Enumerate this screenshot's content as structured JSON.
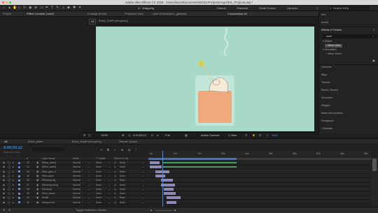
{
  "app": {
    "title": "Adobe After Effects CC 2018 - /Users/lucio/Documents/mi/021/Projects/Argo/021_Project2.aep *"
  },
  "toolbar": {
    "snapping_label": "Snapping",
    "workspaces": [
      "Default",
      "Standard",
      "Small Screen",
      "Libraries"
    ],
    "search_placeholder": "Search Help"
  },
  "project_panel": {
    "tab": "Project"
  },
  "effect_controls_panel": {
    "tab": "Effect Controls (none)"
  },
  "viewer_tabs": [
    "Footage (none)",
    "Flowchart (none)",
    "Layer tEAsidebtes_glassmp",
    "Composition All"
  ],
  "comp_breadcrumb": {
    "all": "All",
    "comp": "tEtea_fluidPouringering"
  },
  "viewer_footer": {
    "zoom": "100%",
    "timecode": "0;00;03;12",
    "resolution": "Full",
    "camera": "Active Camera",
    "view": "1 View",
    "offset": "+0.0"
  },
  "right_panel": {
    "items": [
      "Info",
      "Audio"
    ],
    "effects_title": "Effects & Presets",
    "search_value": "wave",
    "tree": [
      {
        "label": "Distort",
        "indent": 0
      },
      {
        "label": "Wave Warp",
        "indent": 1,
        "selected": true
      },
      {
        "label": "Simulation",
        "indent": 0
      },
      {
        "label": "Wave World",
        "indent": 1,
        "selected": false
      }
    ],
    "items_bottom": [
      "Libraries",
      "Align",
      "Tracker",
      "Motion Sketch",
      "Smoother",
      "Wiggler",
      "Mask Interpolation",
      "Paragraph",
      "Character"
    ]
  },
  "timeline": {
    "tabs": [
      "All",
      "tEtea_water",
      "tEtea_fluidPouringering",
      "Render Queue"
    ],
    "timecode": "0;00;03;12",
    "frame_info": "00102 (29.97 fps)",
    "search_placeholder": "",
    "columns": [
      "#",
      "Layer Name",
      "Mode",
      "T TrkMat",
      "Parent & Link"
    ],
    "ruler_labels": [
      "0s",
      "01s",
      "02s",
      "03s",
      "04s",
      "05s",
      "06s",
      "07s",
      "08s",
      "09s"
    ],
    "layers": [
      {
        "num": "32",
        "name": "[tEtea_water]",
        "mode": "Normal",
        "trkmat": "None",
        "parent": "None",
        "color": "#7a7ad6"
      },
      {
        "num": "33",
        "name": "[tEtea_water]",
        "mode": "Normal",
        "trkmat": "None",
        "parent": "None",
        "color": "#7a7ad6"
      },
      {
        "num": "34",
        "name": "tEtea glass 3",
        "mode": "Normal",
        "trkmat": "None",
        "parent": "None",
        "color": "#6a9ad6"
      },
      {
        "num": "35",
        "name": "tEtea glass",
        "mode": "Normal",
        "trkmat": "None",
        "parent": "None",
        "color": "#6a9ad6"
      },
      {
        "num": "36",
        "name": "tEteabag tag",
        "mode": "Normal",
        "trkmat": "None",
        "parent": "None",
        "color": "#6a9ad6"
      },
      {
        "num": "37",
        "name": "tEteabag string",
        "mode": "Normal",
        "trkmat": "None",
        "parent": "None",
        "color": "#6a9ad6"
      },
      {
        "num": "38",
        "name": "tEteabag",
        "mode": "Normal",
        "trkmat": "None",
        "parent": "None",
        "color": "#6a9ad6"
      },
      {
        "num": "39",
        "name": "tEtea_steam",
        "mode": "Normal",
        "trkmat": "None",
        "parent": "None",
        "color": "#6a9ad6"
      },
      {
        "num": "40",
        "name": "tEmilk",
        "mode": "Normal",
        "trkmat": "None",
        "parent": "None",
        "color": "#6a9ad6"
      },
      {
        "num": "41",
        "name": "background",
        "mode": "Normal",
        "trkmat": "None",
        "parent": "None",
        "color": "#6a9ad6"
      }
    ],
    "footer_label": "Toggle Switches / Modes"
  },
  "colors": {
    "canvas": "#a7d9c8",
    "accent": "#2f8ef0",
    "timecode": "#3b8eea",
    "liquid": "#f0a97a",
    "track_lavender": "#8e8ab8",
    "track_green": "#4f9a64"
  }
}
